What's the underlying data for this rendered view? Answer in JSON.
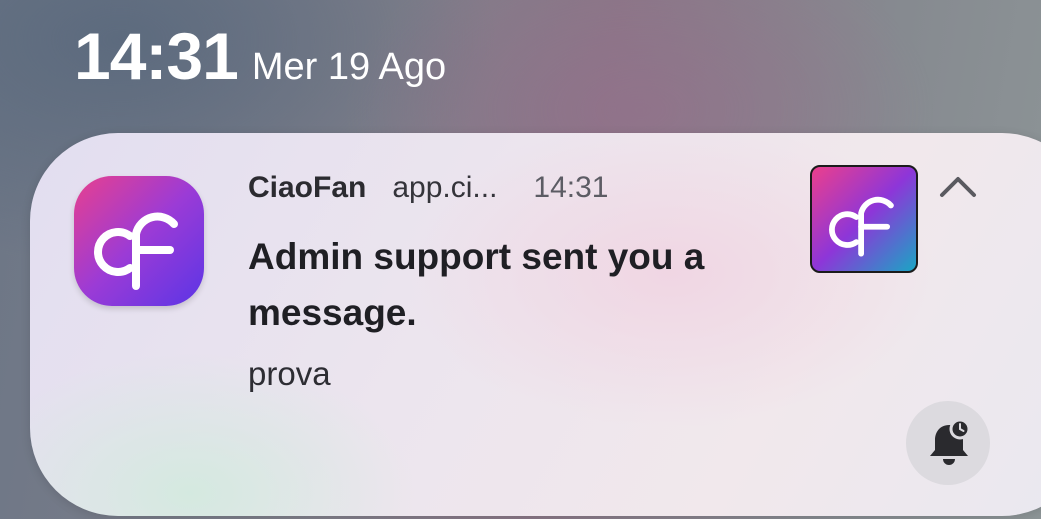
{
  "status_bar": {
    "time": "14:31",
    "date": "Mer 19 Ago"
  },
  "notification": {
    "app_icon": "ciaofan-logo-icon",
    "app_name": "CiaoFan",
    "app_url": "app.ci...",
    "time": "14:31",
    "title": "Admin support sent you a message.",
    "body": "prova",
    "thumbnail": "ciaofan-logo-icon",
    "collapse_icon": "chevron-up-icon",
    "action_icon": "bell-snooze-icon"
  },
  "colors": {
    "brand_pink": "#e8408e",
    "brand_purple": "#9b3bd6",
    "brand_violet": "#5b35e6",
    "brand_teal": "#1aa6c4"
  }
}
